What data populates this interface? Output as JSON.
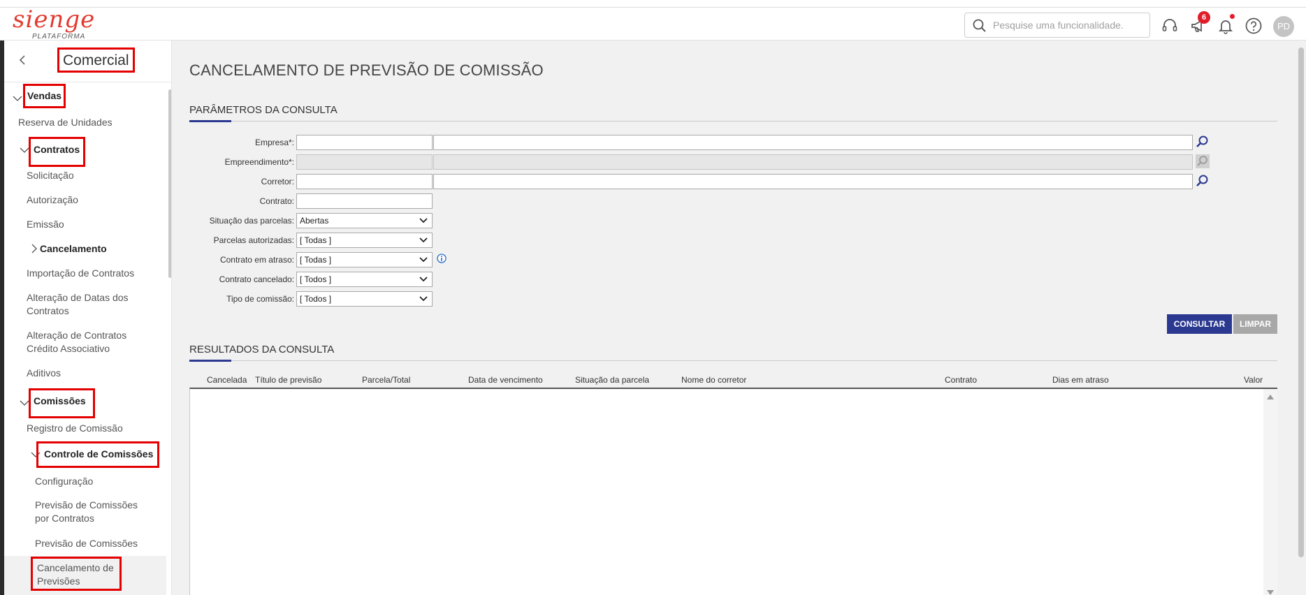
{
  "header": {
    "logo_text": "sienge",
    "logo_sub": "PLATAFORMA",
    "search_placeholder": "Pesquise uma funcionalidade.",
    "notifications_count": "6",
    "avatar_initials": "PD"
  },
  "sidebar": {
    "title": "Comercial",
    "items": {
      "vendas": "Vendas",
      "reserva": "Reserva de Unidades",
      "contratos": "Contratos",
      "solicitacao": "Solicitação",
      "autorizacao": "Autorização",
      "emissao": "Emissão",
      "cancelamento": "Cancelamento",
      "importacao": "Importação de Contratos",
      "alteracao_datas_1": "Alteração de Datas dos",
      "alteracao_datas_2": "Contratos",
      "alteracao_cred_1": "Alteração de Contratos",
      "alteracao_cred_2": "Crédito Associativo",
      "aditivos": "Aditivos",
      "comissoes": "Comissões",
      "registro": "Registro de Comissão",
      "controle": "Controle de Comissões",
      "configuracao": "Configuração",
      "prev_contratos_1": "Previsão de Comissões",
      "prev_contratos_2": "por Contratos",
      "prev_comissoes": "Previsão de Comissões",
      "cancel_prev_1": "Cancelamento de",
      "cancel_prev_2": "Previsões"
    }
  },
  "main": {
    "page_title": "CANCELAMENTO DE PREVISÃO DE COMISSÃO",
    "params_title": "PARÂMETROS DA CONSULTA",
    "results_title": "RESULTADOS DA CONSULTA",
    "fields": {
      "empresa": "Empresa*:",
      "empreendimento": "Empreendimento*:",
      "corretor": "Corretor:",
      "contrato": "Contrato:",
      "situacao": "Situação das parcelas:",
      "parcelas_aut": "Parcelas autorizadas:",
      "atraso": "Contrato em atraso:",
      "cancelado": "Contrato cancelado:",
      "tipo": "Tipo de comissão:"
    },
    "selects": {
      "situacao": "Abertas",
      "parcelas_aut": "[ Todas ]",
      "atraso": "[ Todas ]",
      "cancelado": "[ Todos ]",
      "tipo": "[ Todos ]"
    },
    "buttons": {
      "consultar": "CONSULTAR",
      "limpar": "LIMPAR"
    },
    "table_headers": [
      "Cancelada",
      "Título de previsão",
      "Parcela/Total",
      "Data de vencimento",
      "Situação da parcela",
      "Nome do corretor",
      "Contrato",
      "Dias em atraso",
      "Valor"
    ]
  },
  "colors": {
    "brand": "#e23b30",
    "primary_button": "#2b3990",
    "highlight_box": "#e40000"
  }
}
